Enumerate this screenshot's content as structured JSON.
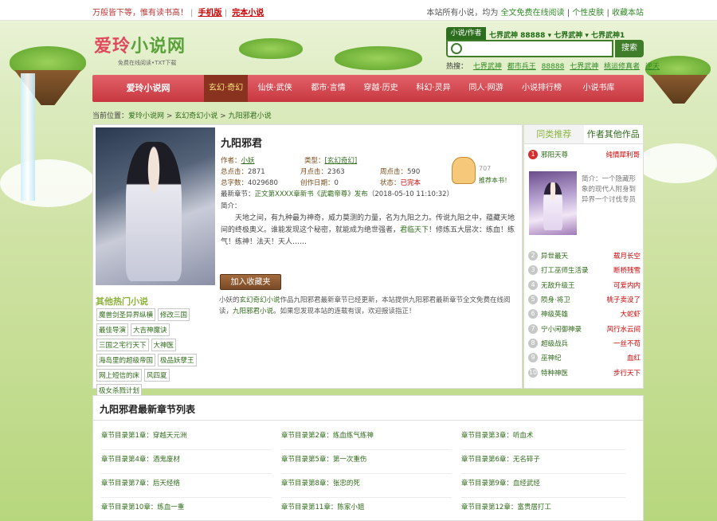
{
  "topbar": {
    "slogan": "万般皆下等，惟有读书高！",
    "mobile": "手机版",
    "complete": "完本小说",
    "notice_prefix": "本站所有小说，均为",
    "notice_link": "全文免费在线阅读",
    "skin": "个性皮肤",
    "bookmark": "收藏本站"
  },
  "logo": {
    "name_a": "爱玲",
    "name_b": "小说网",
    "sub": "免费在线阅读•TXT下载"
  },
  "search": {
    "tag": "小说/作者",
    "options": [
      "七界武神 88888 ▾",
      "七界武神 ▾",
      "七界武神1"
    ],
    "placeholder": "",
    "button": "搜索",
    "hot_label": "热搜：",
    "hot": [
      "七界武神",
      "都市兵王",
      "88888",
      "七界武神",
      "桃运修真者",
      "逆天"
    ]
  },
  "nav": {
    "home": "爱玲小说网",
    "items": [
      "玄幻·奇幻",
      "仙侠·武侠",
      "都市·言情",
      "穿越·历史",
      "科幻·灵异",
      "同人·网游",
      "小说排行榜",
      "小说书库"
    ]
  },
  "breadcrumb": {
    "label": "当前位置：",
    "items": [
      "爱玲小说网",
      "玄幻奇幻小说",
      "九阳邪君小说"
    ],
    "sep": " > "
  },
  "book": {
    "title": "九阳邪君",
    "author_k": "作者：",
    "author": "小妖",
    "type_k": "类型：",
    "type": "[玄幻奇幻]",
    "total_click_k": "总点击：",
    "total_click": "2871",
    "month_click_k": "月点击：",
    "month_click": "2363",
    "week_click_k": "周点击：",
    "week_click": "590",
    "words_k": "总字数：",
    "words": "4029680",
    "created_k": "创作日期：",
    "created": "0",
    "status_k": "状态：",
    "status": "已完本",
    "latest_k": "最新章节：",
    "latest": "正文第XXXX章新书《武霸帝尊》发布",
    "latest_time": "（2018-05-10 11:10:32）",
    "intro_label": "简介：",
    "intro_a": "天地之间，有九种最为神奇，威力莫测的力量，名为九阳之力。传说九阳之中，蕴藏天地间的终极奥义。谁能发现这个秘密，就能成为绝世强者，",
    "intro_g": "君临天下",
    "intro_b": "！修炼五大层次：练血！练气！练神！法天！天人……",
    "fav": "加入收藏夹",
    "thumb_count": "707",
    "thumb_text": "推荐本书！",
    "desc_a": "小妖的",
    "desc_link1": "玄幻奇幻小说",
    "desc_b": "作品九阳邪君最新章节已经更新，本站提供九阳邪君最新章节全文免费在线阅读，",
    "desc_link2": "九阳邪君小说",
    "desc_c": "。如果您发现本站的连载有误，欢迎报读指正！"
  },
  "other_hot": {
    "title": "其他热门小说",
    "items": [
      "魔兽剑圣异界纵横",
      "修改三国",
      "最佳导演",
      "大吉神魔诀",
      "三国之宅行天下",
      "大神医",
      "海岛里的超级帝国",
      "极品妖孽王",
      "网上短信的床",
      "风四夏",
      "极女杀戮计划"
    ]
  },
  "sidebar": {
    "tab_similar": "同类推荐",
    "tab_author": "作者其他作品",
    "first": {
      "num": "1",
      "book": "邪阳天尊",
      "author": "纯情犀利哥"
    },
    "desc": "简介：一个隐藏形象的现代人附身到异界一个讨伐专员",
    "list": [
      {
        "num": "2",
        "book": "异世最天",
        "author": "载月长空"
      },
      {
        "num": "3",
        "book": "打工巫师生活录",
        "author": "断桥残雪"
      },
      {
        "num": "4",
        "book": "无敌升级王",
        "author": "可爱内内"
      },
      {
        "num": "5",
        "book": "陨身·将卫",
        "author": "桃子卖没了"
      },
      {
        "num": "6",
        "book": "神级英雄",
        "author": "大蛇虾"
      },
      {
        "num": "7",
        "book": "宁小闲御神录",
        "author": "风行水云间"
      },
      {
        "num": "8",
        "book": "超级战兵",
        "author": "一丝不苟"
      },
      {
        "num": "9",
        "book": "巫神纪",
        "author": "血红"
      },
      {
        "num": "10",
        "book": "特种神医",
        "author": "步行天下"
      }
    ]
  },
  "chapters": {
    "title": "九阳邪君最新章节列表",
    "items": [
      "章节目录第1章：穿越天元洲",
      "章节目录第2章：练血练气练神",
      "章节目录第3章：听血术",
      "章节目录第4章：酒鬼废材",
      "章节目录第5章：第一次重伤",
      "章节目录第6章：无名碎子",
      "章节目录第7章：后天经络",
      "章节目录第8章：张忠的死",
      "章节目录第9章：血经武经",
      "章节目录第10章：练血一重",
      "章节目录第11章：陈家小姐",
      "章节目录第12章：富贵居打工"
    ]
  }
}
